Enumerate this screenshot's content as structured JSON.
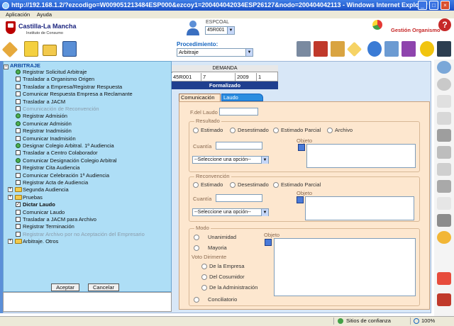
{
  "window": {
    "title": "http://192.168.1.2/?ezcodigo=W009051213484ESP000&ezcoy1=200404042034ESP26127&nodo=200404042113 - Windows Internet Explorer",
    "controls": [
      "_",
      "□",
      "×"
    ]
  },
  "menubar": [
    "Aplicación",
    "Ayuda"
  ],
  "header": {
    "logo_title": "Castilla-La Mancha",
    "logo_subtitle": "Instituto de Consumo",
    "user_label": "ESPCOAL",
    "user_value": "45R001",
    "gestion_label": "Gestión Organismo",
    "help_glyph": "?",
    "procedimiento_label": "Procedimiento:",
    "procedimiento_value": "Arbitraje"
  },
  "expediente": {
    "header": "DEMANDA",
    "cells": [
      "45R001",
      "7",
      "2009",
      "1"
    ],
    "status": "Formalizado"
  },
  "tabs": [
    "Comunicación",
    "Laudo"
  ],
  "form": {
    "fecha_label": "F.del Laudo",
    "resultado_legend": "Resultado",
    "resultado_options": [
      "Estimado",
      "Desestimado",
      "Estimado Parcial",
      "Archivo"
    ],
    "cuantia_label": "Cuantía",
    "objeto_label": "Objeto",
    "select_placeholder": "--Seleccione una opción--",
    "reconvencion_legend": "Reconvención",
    "reconvencion_options": [
      "Estimado",
      "Desestimado",
      "Estimado Parcial"
    ],
    "modo_legend": "Modo",
    "modo_options": [
      "Unanimidad",
      "Mayoria"
    ],
    "voto_label": "Voto Dirimente",
    "voto_options": [
      "De la Empresa",
      "Del Cosumidor",
      "De la Administración"
    ],
    "conciliatorio_label": "Conciliatorio"
  },
  "tree": {
    "root": "ARBITRAJE",
    "items": [
      {
        "label": "Registrar Solicitud Arbitraje",
        "state": "done"
      },
      {
        "label": "Trasladar a Organismo Origen",
        "state": "unchecked"
      },
      {
        "label": "Trasladar a Empresa/Registrar Respuesta",
        "state": "unchecked"
      },
      {
        "label": "Comunicar Respuesta Empresa a Reclamante",
        "state": "unchecked"
      },
      {
        "label": "Trasladar a JACM",
        "state": "unchecked"
      },
      {
        "label": "Comunicación de Reconvención",
        "state": "disabled"
      },
      {
        "label": "Registrar Admisión",
        "state": "done"
      },
      {
        "label": "Comunicar Admisión",
        "state": "done"
      },
      {
        "label": "Registrar Inadmisión",
        "state": "unchecked"
      },
      {
        "label": "Comunicar Inadmisión",
        "state": "unchecked"
      },
      {
        "label": "Designar Colegio Arbitral. 1ª Audiencia",
        "state": "done"
      },
      {
        "label": "Trasladar a Centro Colaborador",
        "state": "unchecked"
      },
      {
        "label": "Comunicar Designación Colegio Arbitral",
        "state": "done"
      },
      {
        "label": "Registrar Cita Audiencia",
        "state": "unchecked"
      },
      {
        "label": "Comunicar Celebración 1ª Audiencia",
        "state": "unchecked"
      },
      {
        "label": "Registrar Acta de Audiencia",
        "state": "unchecked"
      },
      {
        "label": "Segunda Audiencia",
        "state": "folder"
      },
      {
        "label": "Pruebas",
        "state": "folder"
      },
      {
        "label": "Dictar Laudo",
        "state": "checked"
      },
      {
        "label": "Comunicar Laudo",
        "state": "unchecked"
      },
      {
        "label": "Trasladar a JACM para Archivo",
        "state": "unchecked"
      },
      {
        "label": "Registrar Terminación",
        "state": "unchecked"
      },
      {
        "label": "Registrar Archivo por no Aceptación del Empresario",
        "state": "disabled"
      },
      {
        "label": "Arbitraje. Otros",
        "state": "folder"
      }
    ],
    "accept": "Aceptar",
    "cancel": "Cancelar"
  },
  "statusbar": {
    "zone": "Sitios de confianza",
    "zoom": "100%"
  }
}
